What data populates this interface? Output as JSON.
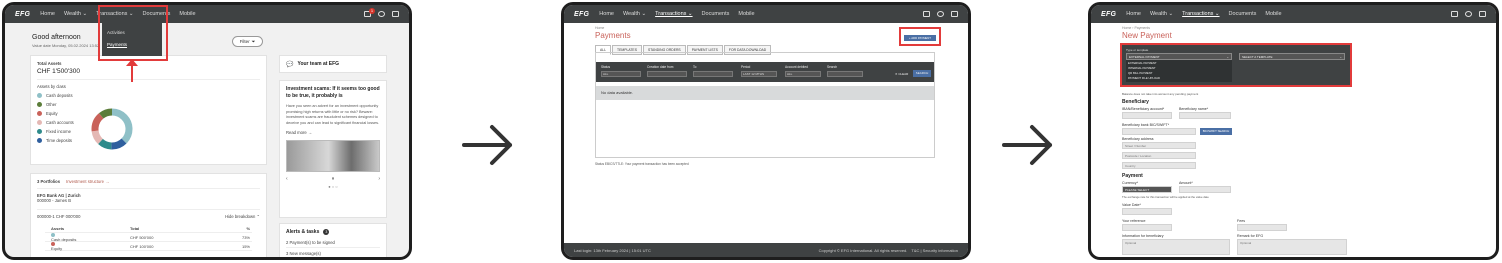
{
  "screen1": {
    "nav": {
      "logo": "EFG",
      "items": [
        "Home",
        "Wealth ⌄",
        "Transactions ⌄",
        "Documents",
        "Mobile"
      ],
      "badge": "1"
    },
    "dropdown": [
      "Activities",
      "Payments"
    ],
    "greeting": "Good afternoon",
    "value_date": "Value date Monday, 05.02.2024 13:52",
    "filter_label": "Filter",
    "total_assets_label": "Total Assets",
    "total_assets_value": "CHF 1'500'300",
    "assets_by_class_label": "Assets by class",
    "asset_classes": [
      {
        "name": "Cash deposits",
        "color": "#8fc0c7"
      },
      {
        "name": "Other",
        "color": "#5b7d3a"
      },
      {
        "name": "Equity",
        "color": "#c9625a"
      },
      {
        "name": "Cash accounts",
        "color": "#e4b8b4"
      },
      {
        "name": "Fixed income",
        "color": "#2e8b8b"
      },
      {
        "name": "Time deposits",
        "color": "#2f5f9e"
      }
    ],
    "portfolios_label": "3 Portfolios",
    "investment_structure_link": "Investment structure →",
    "bank_line": "EFG Bank AG | Zurich",
    "account_line": "000000 - James B",
    "portfolio_id": "000000-1   CHF 000'000",
    "hide_breakdown": "Hide breakdown ⌃",
    "table_headers": [
      "Assets",
      "Total",
      "%"
    ],
    "table_rows": [
      [
        "Cash deposits",
        "CHF 500'000",
        "73%"
      ],
      [
        "Equity",
        "CHF 100'000",
        "15%"
      ]
    ],
    "team_title": "Your team at EFG",
    "scam_title": "Investment scams: If it seems too good to be true, it probably is",
    "scam_body": "Have you seen an advert for an investment opportunity promising high returns with little or no risk? Beware: investment scams are fraudulent schemes designed to deceive you and can lead to significant financial losses.",
    "read_more": "Read more →",
    "alerts_title": "Alerts & tasks",
    "alerts_count": "3",
    "alert_items": [
      "2 Payment(s) to be signed",
      "3 New message(s)"
    ]
  },
  "screen2": {
    "nav_items": [
      "Home",
      "Wealth ⌄",
      "Transactions ⌄",
      "Documents",
      "Mobile"
    ],
    "breadcrumb": "Home",
    "title": "Payments",
    "add_payment": "+ ADD PAYMENT",
    "tabs": [
      "ALL",
      "TEMPLATES",
      "STANDING ORDERS",
      "PAYMENT LISTS",
      "FOR DATA DOWNLOAD"
    ],
    "filters": [
      "Status",
      "Creation date from",
      "To",
      "Period",
      "Account debited",
      "Search"
    ],
    "filter_values": [
      "ALL",
      "",
      "",
      "LAST 12 MTHS",
      "ALL",
      ""
    ],
    "clear": "✕ CLEAR",
    "search_btn": "SEARCH",
    "no_data": "No data available.",
    "status_note": "Status EBICS/TTLE: Your payment transaction has been accepted",
    "footer_left": "Last login: 13th February 2024 | 15:01 UTC",
    "footer_right": "Copyright © EFG International. All rights reserved.",
    "footer_links": "T&C | Security information"
  },
  "screen3": {
    "nav_items": [
      "Home",
      "Wealth ⌄",
      "Transactions ⌄",
      "Documents",
      "Mobile"
    ],
    "breadcrumb": "Home  ›  Payments",
    "title": "New Payment",
    "type_label": "Type or template",
    "type_value": "EXTERNAL PAYMENT",
    "template_value": "SELECT A TEMPLATE",
    "type_options": [
      "EXTERNAL PAYMENT",
      "INTERNAL PAYMENT",
      "QR BILL PAYMENT",
      "PAYMENT FILE UPLOAD"
    ],
    "balance_note": "Balance does not take into account any pending payment",
    "beneficiary_title": "Beneficiary",
    "iban_label": "IBAN/Beneficiary account*",
    "name_label": "Beneficiary name*",
    "bank_label": "Beneficiary bank BIC/SWIFT*",
    "bic_search": "BIC/SWIFT SEARCH",
    "address_label": "Beneficiary address",
    "address_placeholders": [
      "Street / Number",
      "Postcode / Location",
      "Country"
    ],
    "payment_title": "Payment",
    "currency_label": "Currency*",
    "currency_value": "PLEASE SELECT",
    "amount_label": "Amount*",
    "exchange_note": "The exchange rate for this transaction will be applied at the value date",
    "value_date_label": "Value Date*",
    "your_ref_label": "Your reference",
    "fees_label": "Fees",
    "info_label": "Information for beneficiary",
    "info_placeholder": "Optional",
    "remark_label": "Remark for EFG"
  }
}
